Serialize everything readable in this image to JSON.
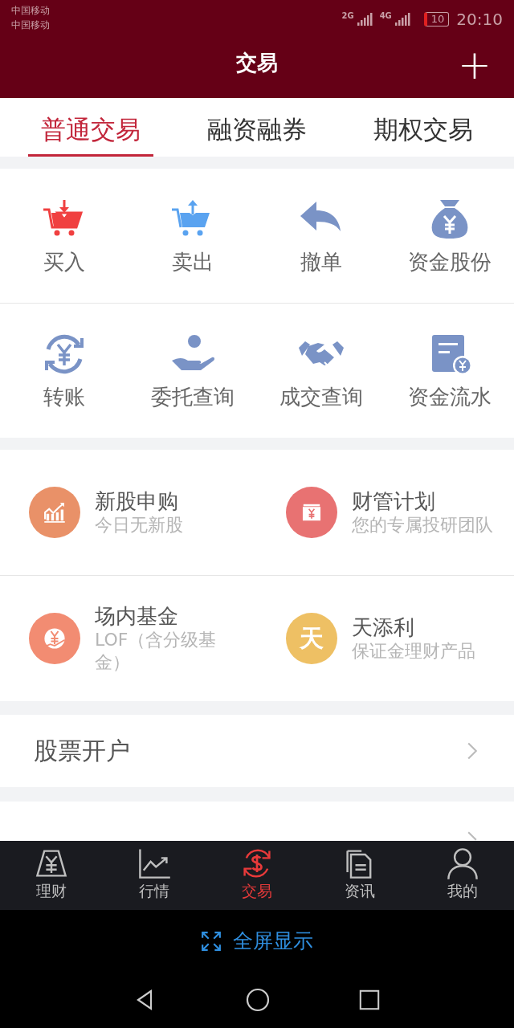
{
  "status_bar": {
    "carriers": [
      "中国移动",
      "中国移动"
    ],
    "networks": [
      "2G",
      "4G"
    ],
    "battery": "10",
    "time": "20:10"
  },
  "header": {
    "title": "交易",
    "add_symbol": "+"
  },
  "tabs": [
    {
      "label": "普通交易",
      "selected": true
    },
    {
      "label": "融资融券",
      "selected": false
    },
    {
      "label": "期权交易",
      "selected": false
    }
  ],
  "actions": [
    {
      "label": "买入"
    },
    {
      "label": "卖出"
    },
    {
      "label": "撤单"
    },
    {
      "label": "资金股份"
    },
    {
      "label": "转账"
    },
    {
      "label": "委托查询"
    },
    {
      "label": "成交查询"
    },
    {
      "label": "资金流水"
    }
  ],
  "products": [
    {
      "title": "新股申购",
      "subtitle": "今日无新股",
      "color": "#e99168"
    },
    {
      "title": "财管计划",
      "subtitle": "您的专属投研团队",
      "color": "#e87272"
    },
    {
      "title": "场内基金",
      "subtitle": "LOF（含分级基金）",
      "color": "#f28c72"
    },
    {
      "title": "天添利",
      "subtitle": "保证金理财产品",
      "color": "#eec064",
      "icon_text": "天"
    }
  ],
  "menu_rows": [
    {
      "label": "股票开户"
    }
  ],
  "next_row_cut_off": true,
  "bottom_nav": [
    {
      "label": "理财",
      "selected": false
    },
    {
      "label": "行情",
      "selected": false
    },
    {
      "label": "交易",
      "selected": true
    },
    {
      "label": "资讯",
      "selected": false
    },
    {
      "label": "我的",
      "selected": false
    }
  ],
  "fullscreen": {
    "label": "全屏显示"
  }
}
